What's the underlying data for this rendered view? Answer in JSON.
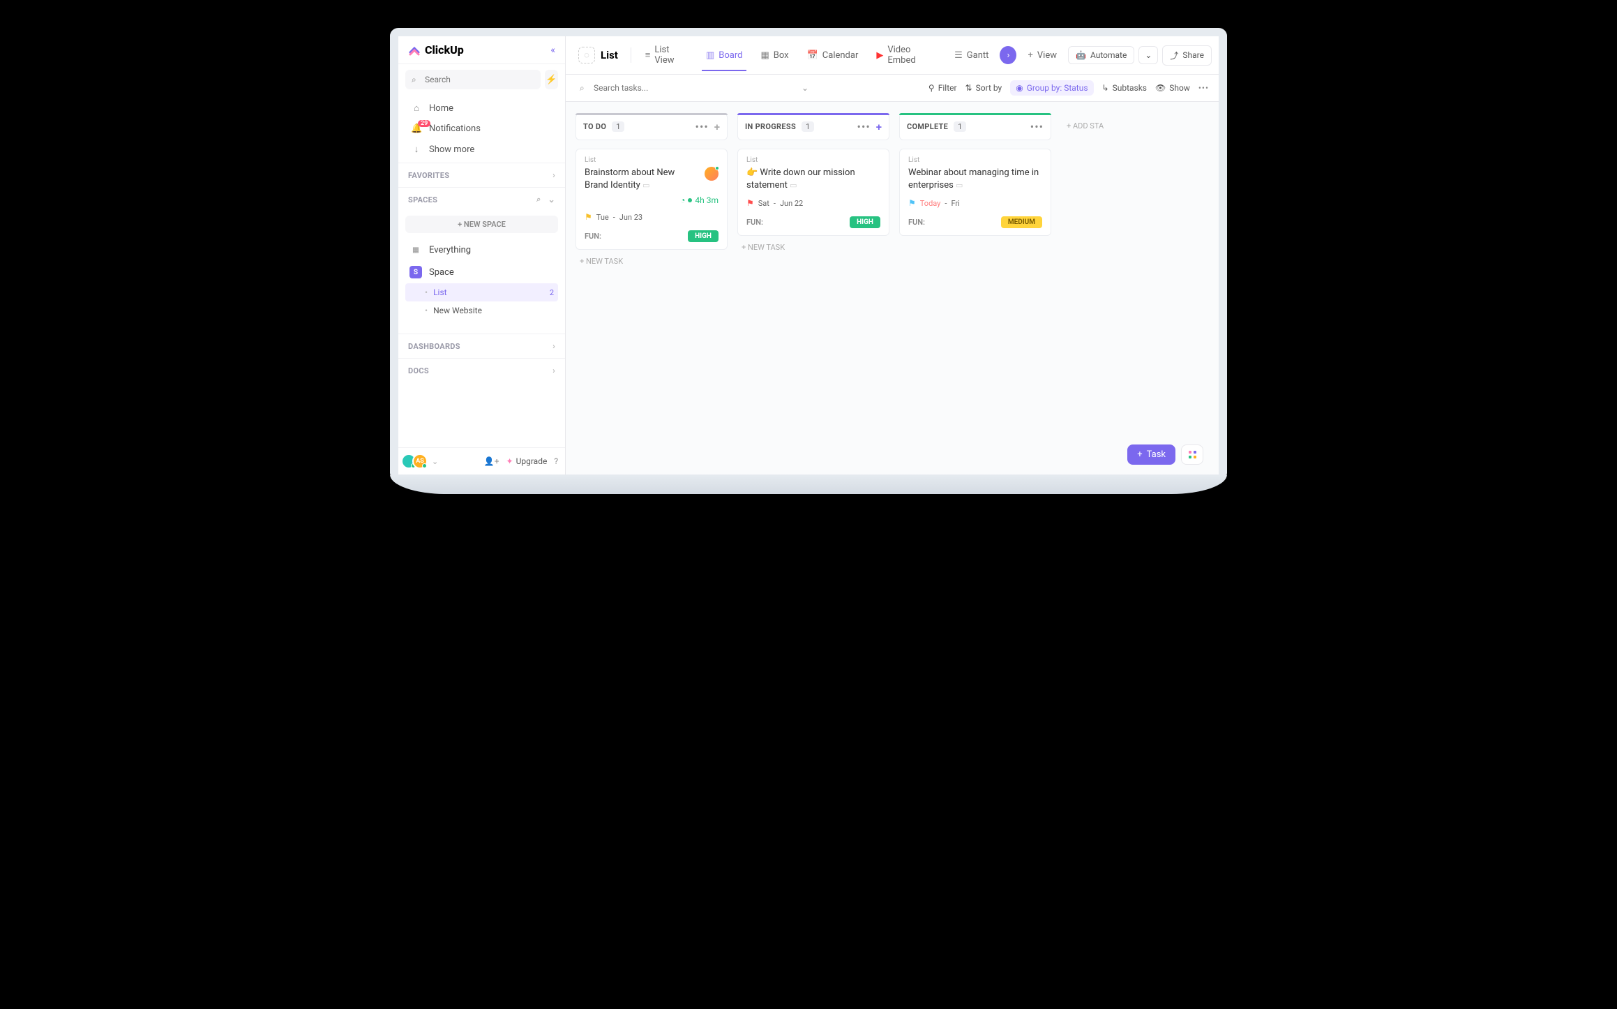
{
  "brand": "ClickUp",
  "sidebar": {
    "search_placeholder": "Search",
    "nav": {
      "home": "Home",
      "notifications": "Notifications",
      "notifications_count": "29",
      "show_more": "Show more"
    },
    "sections": {
      "favorites": "FAVORITES",
      "spaces": "SPACES",
      "dashboards": "DASHBOARDS",
      "docs": "DOCS"
    },
    "new_space": "+  NEW SPACE",
    "everything": "Everything",
    "space_name": "Space",
    "list_name": "List",
    "list_count": "2",
    "new_website": "New Website",
    "upgrade": "Upgrade",
    "avatar2_initials": "AS"
  },
  "topbar": {
    "title": "List",
    "tabs": {
      "list_view": "List View",
      "board": "Board",
      "box": "Box",
      "calendar": "Calendar",
      "video_embed": "Video Embed",
      "gantt": "Gantt",
      "view": "View"
    },
    "automate": "Automate",
    "share": "Share"
  },
  "toolbar": {
    "search_placeholder": "Search tasks...",
    "filter": "Filter",
    "sort": "Sort by",
    "group": "Group by: Status",
    "subtasks": "Subtasks",
    "show": "Show"
  },
  "columns": {
    "todo": {
      "title": "TO DO",
      "count": "1"
    },
    "progress": {
      "title": "IN PROGRESS",
      "count": "1"
    },
    "complete": {
      "title": "COMPLETE",
      "count": "1"
    }
  },
  "cards": {
    "c1": {
      "sub": "List",
      "title": "Brainstorm about New Brand Identity",
      "timer": "4h 3m",
      "date_from": "Tue",
      "date_to": "Jun 23",
      "cf_label": "FUN:",
      "cf_value": "HIGH"
    },
    "c2": {
      "sub": "List",
      "title": "Write down our mission statement",
      "date_from": "Sat",
      "date_to": "Jun 22",
      "cf_label": "FUN:",
      "cf_value": "HIGH"
    },
    "c3": {
      "sub": "List",
      "title": "Webinar about managing time in enterprises",
      "date_from": "Today",
      "date_to": "Fri",
      "cf_label": "FUN:",
      "cf_value": "MEDIUM"
    }
  },
  "board": {
    "new_task": "+ NEW TASK",
    "add_status": "+ ADD STA"
  },
  "float": {
    "task": "Task"
  }
}
